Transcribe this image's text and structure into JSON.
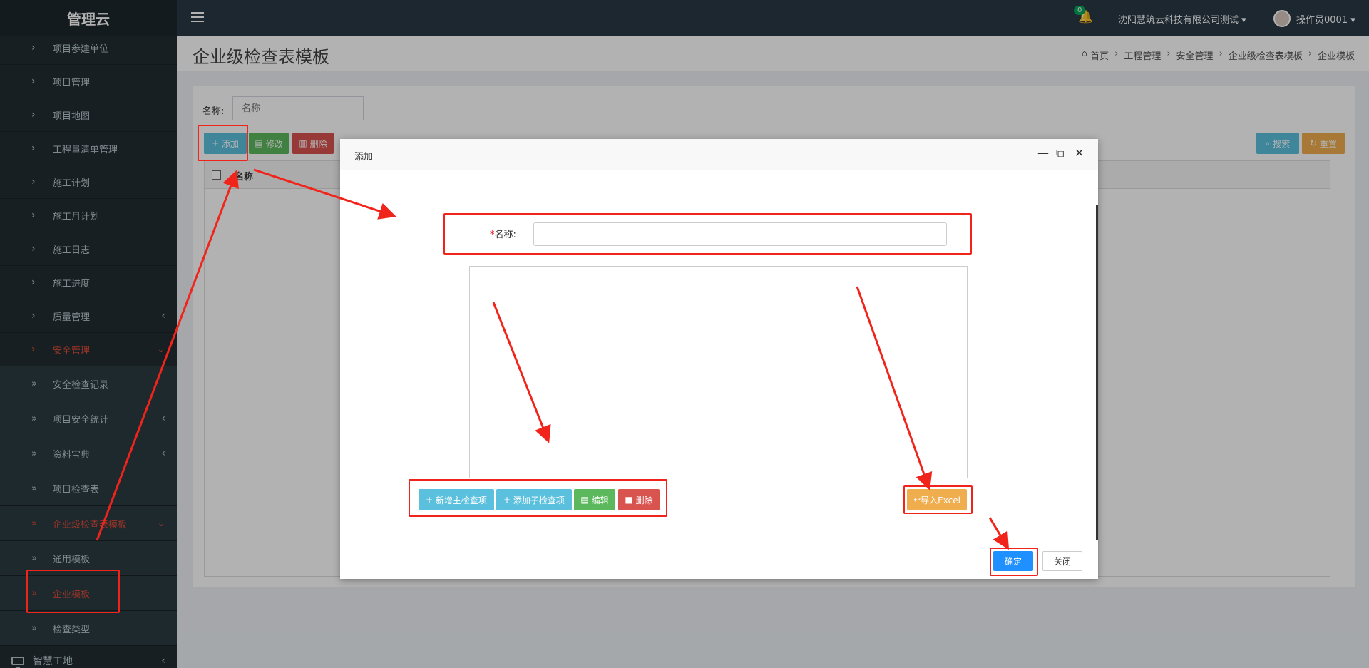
{
  "app": {
    "logo": "管理云"
  },
  "sidebar": {
    "items": [
      {
        "label": "项目参建单位",
        "icon": "chevron-right"
      },
      {
        "label": "项目管理",
        "icon": "chevron-right"
      },
      {
        "label": "项目地图",
        "icon": "chevron-right"
      },
      {
        "label": "工程量清单管理",
        "icon": "chevron-right"
      },
      {
        "label": "施工计划",
        "icon": "chevron-right"
      },
      {
        "label": "施工月计划",
        "icon": "chevron-right"
      },
      {
        "label": "施工日志",
        "icon": "chevron-right"
      },
      {
        "label": "施工进度",
        "icon": "chevron-right"
      },
      {
        "label": "质量管理",
        "icon": "chevron-right"
      },
      {
        "label": "安全管理",
        "icon": "chevron-right"
      },
      {
        "label": "安全检查记录",
        "icon": "double-chevron"
      },
      {
        "label": "项目安全统计",
        "icon": "double-chevron"
      },
      {
        "label": "资料宝典",
        "icon": "double-chevron"
      },
      {
        "label": "项目检查表",
        "icon": "double-chevron"
      },
      {
        "label": "企业级检查表模板",
        "icon": "double-chevron"
      },
      {
        "label": "通用模板",
        "icon": "double-chevron"
      },
      {
        "label": "企业模板",
        "icon": "double-chevron"
      },
      {
        "label": "检查类型",
        "icon": "double-chevron"
      }
    ],
    "bottom_item": "智慧工地",
    "active_color": "#dd4b39"
  },
  "header": {
    "notification_count": "0",
    "company": "沈阳慧筑云科技有限公司测试",
    "operator": "操作员0001"
  },
  "page": {
    "title": "企业级检查表模板",
    "breadcrumb": [
      "首页",
      "工程管理",
      "安全管理",
      "企业级检查表模板",
      "企业模板"
    ]
  },
  "search": {
    "label": "名称:",
    "placeholder": "名称"
  },
  "toolbar": {
    "add": "添加",
    "edit": "修改",
    "delete": "删除",
    "search": "搜索",
    "reset": "重置"
  },
  "table": {
    "column": "名称"
  },
  "modal": {
    "title": "添加",
    "name_label": "名称:",
    "required_mark": "*",
    "buttons": {
      "add_main": "新增主检查项",
      "add_sub": "添加子检查项",
      "edit": "编辑",
      "delete": "删除",
      "import_excel": "导入Excel",
      "confirm": "确定",
      "close": "关闭"
    }
  },
  "annotation_color": "#f0241a"
}
